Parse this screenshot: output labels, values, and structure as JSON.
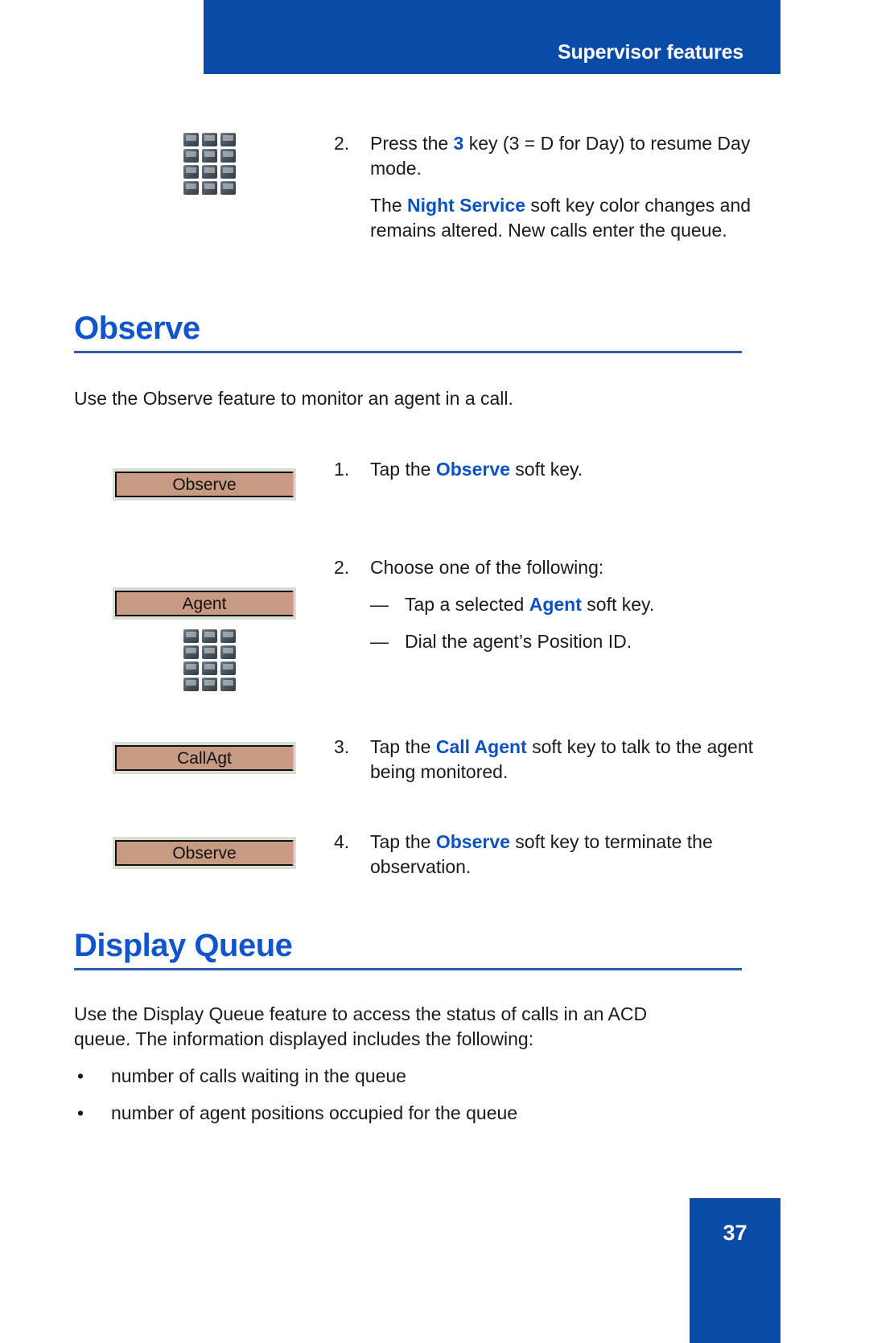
{
  "header": {
    "title": "Supervisor features",
    "bar_color": "#0a4ba8"
  },
  "colors": {
    "heading_blue": "#1155cc",
    "emphasis_blue": "#0a52c4",
    "rule_blue": "#2f5fa8",
    "softkey_fill": "#c99a82",
    "softkey_backing": "#d6dfd2",
    "keypad_key": "#46515a"
  },
  "top_step": {
    "number": "2.",
    "line1_a": "Press the ",
    "line1_key": "3",
    "line1_b": " key (3 = D for Day) to resume Day mode.",
    "para_a": "The ",
    "para_key": "Night Service",
    "para_b": " soft key color changes and remains altered. New calls enter the queue.",
    "icon": "keypad-icon"
  },
  "sections": [
    {
      "title": "Observe",
      "intro": "Use the Observe feature to monitor an agent in a call.",
      "steps": [
        {
          "number": "1.",
          "text_a": "Tap the ",
          "key": "Observe",
          "text_b": " soft key.",
          "softkey_label": "Observe"
        },
        {
          "number": "2.",
          "text_a": "Choose one of the following:",
          "key": "",
          "text_b": "",
          "softkey_label": "Agent",
          "sub_items": [
            {
              "dash": "—",
              "text_a": "Tap a selected ",
              "key": "Agent",
              "text_b": " soft key."
            },
            {
              "dash": "—",
              "text_a": "Dial the agent’s Position ID.",
              "key": "",
              "text_b": ""
            }
          ]
        },
        {
          "number": "3.",
          "text_a": "Tap the ",
          "key": "Call Agent",
          "text_b": " soft key to talk to the agent being monitored.",
          "softkey_label": "CallAgt"
        },
        {
          "number": "4.",
          "text_a": "Tap the ",
          "key": "Observe",
          "text_b": " soft key to terminate the observation.",
          "softkey_label": "Observe"
        }
      ]
    },
    {
      "title": "Display Queue",
      "intro": "Use the Display Queue feature to access the status of calls in an ACD queue. The information displayed includes the following:",
      "bullets": [
        {
          "mark": "•",
          "text": "number of calls waiting in the queue"
        },
        {
          "mark": "•",
          "text": "number of agent positions occupied for the queue"
        }
      ]
    }
  ],
  "footer": {
    "page_number": "37"
  }
}
